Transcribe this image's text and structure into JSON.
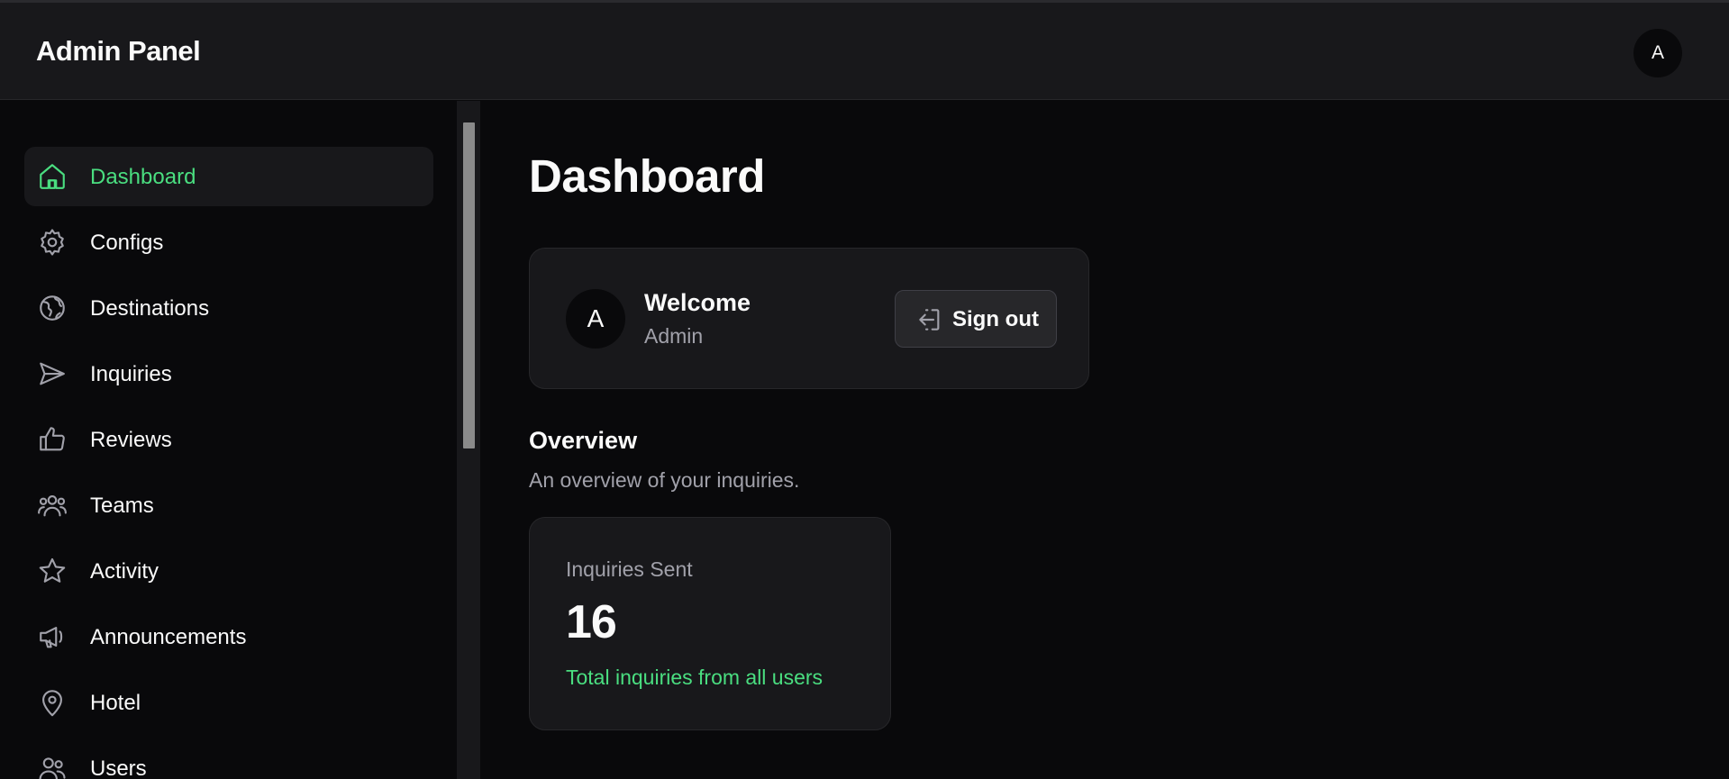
{
  "header": {
    "title": "Admin Panel",
    "avatar_initial": "A"
  },
  "sidebar": {
    "items": [
      {
        "label": "Dashboard",
        "icon": "home-icon",
        "active": true
      },
      {
        "label": "Configs",
        "icon": "gear-icon",
        "active": false
      },
      {
        "label": "Destinations",
        "icon": "globe-icon",
        "active": false
      },
      {
        "label": "Inquiries",
        "icon": "send-icon",
        "active": false
      },
      {
        "label": "Reviews",
        "icon": "thumbs-up-icon",
        "active": false
      },
      {
        "label": "Teams",
        "icon": "team-icon",
        "active": false
      },
      {
        "label": "Activity",
        "icon": "star-icon",
        "active": false
      },
      {
        "label": "Announcements",
        "icon": "megaphone-icon",
        "active": false
      },
      {
        "label": "Hotel",
        "icon": "map-pin-icon",
        "active": false
      },
      {
        "label": "Users",
        "icon": "users-icon",
        "active": false
      }
    ]
  },
  "main": {
    "page_title": "Dashboard",
    "welcome": {
      "avatar_initial": "A",
      "title": "Welcome",
      "subtitle": "Admin",
      "signout_label": "Sign out"
    },
    "overview": {
      "title": "Overview",
      "subtitle": "An overview of your inquiries.",
      "stat": {
        "label": "Inquiries Sent",
        "value": "16",
        "footnote": "Total inquiries from all users"
      }
    }
  },
  "colors": {
    "accent": "#4ade80",
    "background": "#09090b",
    "surface": "#18181b",
    "muted_text": "#a1a1aa"
  }
}
